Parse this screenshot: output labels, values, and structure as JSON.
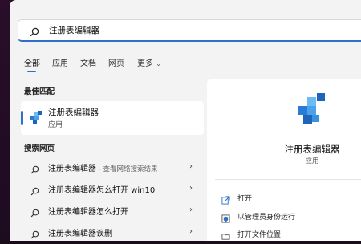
{
  "search": {
    "query": "注册表编辑器"
  },
  "tabs": [
    {
      "label": "全部"
    },
    {
      "label": "应用"
    },
    {
      "label": "文档"
    },
    {
      "label": "网页"
    },
    {
      "label": "更多"
    }
  ],
  "best_match": {
    "title": "最佳匹配",
    "name": "注册表编辑器",
    "type": "应用"
  },
  "web": {
    "title": "搜索网页",
    "results": [
      {
        "label": "注册表编辑器",
        "hint": " - 查看网络搜索结果"
      },
      {
        "label": "注册表编辑器怎么打开 win10",
        "hint": ""
      },
      {
        "label": "注册表编辑器怎么打开",
        "hint": ""
      },
      {
        "label": "注册表编辑器误删",
        "hint": ""
      }
    ]
  },
  "detail": {
    "name": "注册表编辑器",
    "type": "应用",
    "actions": [
      {
        "label": "打开",
        "icon": "open-icon"
      },
      {
        "label": "以管理员身份运行",
        "icon": "admin-shield-icon"
      },
      {
        "label": "打开文件位置",
        "icon": "folder-icon"
      }
    ]
  },
  "colors": {
    "accent": "#2f6fc9",
    "panel": "#f3f3f3",
    "card": "#ffffff"
  }
}
